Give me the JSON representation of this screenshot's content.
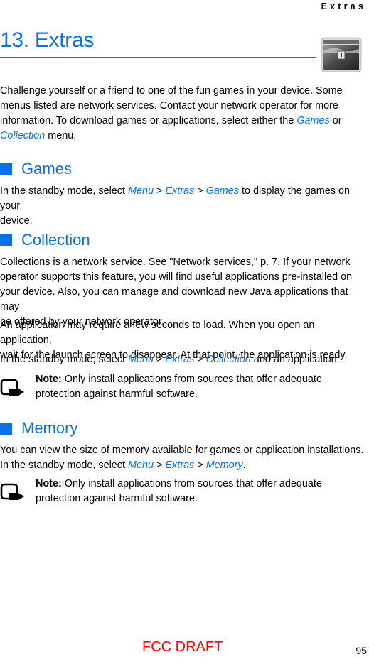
{
  "running_head": "Extras",
  "chapter": {
    "title": "13. Extras",
    "icon": "treasure-chest-icon"
  },
  "intro": {
    "lines": [
      "Challenge yourself or a friend to one of the fun games in your device. Some",
      "menus listed are network services. Contact your network operator for more",
      "information. To download games or applications, select either the "
    ],
    "link_games": "Games",
    "after_games": " or",
    "link_collection": "Collection",
    "end": " menu."
  },
  "games": {
    "heading": "Games",
    "pre": "In the standby mode, select ",
    "menu": "Menu",
    "sep": " > ",
    "extras": "Extras",
    "games": "Games",
    "post": " to display the games on your",
    "post2": "device."
  },
  "collection": {
    "heading": "Collection",
    "para1": [
      "Collections is a network service. See \"Network services,\" p. 7. If your network",
      "operator supports this feature, you will find useful applications pre-installed on",
      "your device. Also, you can manage and download new Java applications that may",
      "be offered by your network operator."
    ],
    "para2": [
      "An application may require a few seconds to load. When you open an application,",
      "wait for the launch screen to disappear. At that point, the application is ready."
    ],
    "para3_pre": "In the standby mode, select ",
    "menu": "Menu",
    "sep": " > ",
    "extras": "Extras",
    "collection": "Collection",
    "para3_post": " and an application.",
    "note_label": "Note:",
    "note_line1": " Only install applications from sources that offer adequate",
    "note_line2": "protection against harmful software."
  },
  "memory": {
    "heading": "Memory",
    "line1": "You can view the size of memory available for games or application installations.",
    "pre": "In the standby mode, select ",
    "menu": "Menu",
    "sep": " > ",
    "extras": "Extras",
    "memory": "Memory",
    "post": ".",
    "note_label": "Note:",
    "note_line1": " Only install applications from sources that offer adequate",
    "note_line2": "protection against harmful software."
  },
  "footer": {
    "draft": "FCC DRAFT",
    "page_number": "95"
  }
}
